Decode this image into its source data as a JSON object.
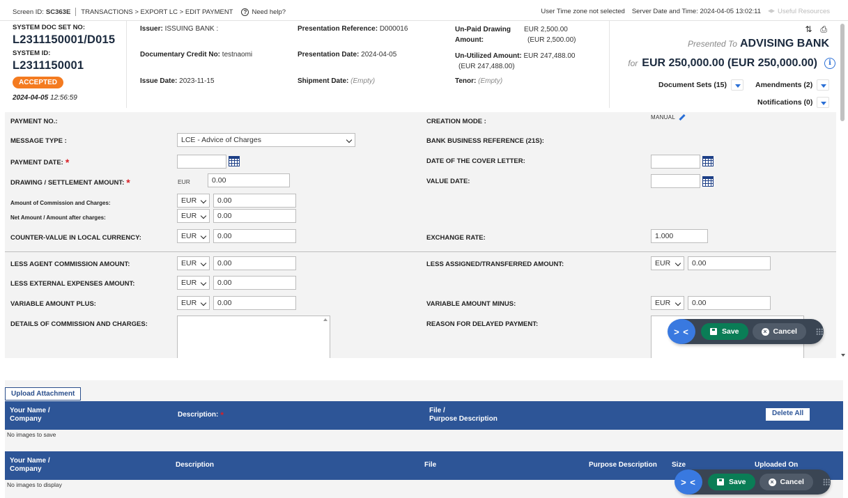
{
  "topbar": {
    "screen_id_label": "Screen ID:",
    "screen_id": "SC363E",
    "breadcrumb": "TRANSACTIONS > EXPORT LC > EDIT PAYMENT",
    "help": "Need help?",
    "timezone": "User Time zone not selected",
    "server_time": "Server Date and Time: 2024-04-05 13:02:11",
    "resources": "Useful Resources"
  },
  "header": {
    "docset_label": "SYSTEM DOC SET NO:",
    "docset": "L2311150001/D015",
    "sysid_label": "SYSTEM ID:",
    "sysid": "L2311150001",
    "status": "ACCEPTED",
    "date": "2024-04-05",
    "time": "12:56:59",
    "issuer_label": "Issuer:",
    "issuer": "ISSUING BANK :",
    "dc_label": "Documentary Credit No:",
    "dc": "testnaomi",
    "issue_label": "Issue Date:",
    "issue": "2023-11-15",
    "pres_ref_label": "Presentation Reference:",
    "pres_ref": "D000016",
    "pres_date_label": "Presentation Date:",
    "pres_date": "2024-04-05",
    "ship_label": "Shipment Date:",
    "ship": "(Empty)",
    "unpaid_label_1": "Un-Paid Drawing",
    "unpaid_label_2": "Amount:",
    "unpaid": "EUR 2,500.00",
    "unpaid_sub": "(EUR 2,500.00)",
    "unutil_label": "Un-Utilized Amount:",
    "unutil": "EUR 247,488.00",
    "unutil_sub": "(EUR 247,488.00)",
    "tenor_label": "Tenor:",
    "tenor": "(Empty)",
    "presented_to": "Presented To",
    "bank": "ADVISING BANK",
    "for": "for",
    "amount": "EUR 250,000.00 (EUR 250,000.00)",
    "doc_sets": "Document Sets (15)",
    "amendments": "Amendments (2)",
    "notifications": "Notifications (0)"
  },
  "form": {
    "payment_no": "PAYMENT NO.:",
    "creation_mode": "CREATION MODE :",
    "creation_mode_value": "MANUAL",
    "message_type": "MESSAGE TYPE :",
    "message_type_value": "LCE - Advice of Charges",
    "bank_ref": "BANK BUSINESS REFERENCE (21S):",
    "payment_date": "PAYMENT DATE:",
    "cover_letter": "DATE OF THE COVER LETTER:",
    "drawing_amount": "DRAWING / SETTLEMENT AMOUNT:",
    "drawing_currency": "EUR",
    "drawing_value": "0.00",
    "value_date": "VALUE DATE:",
    "commission": "Amount of Commission and Charges:",
    "net_amount": "Net Amount / Amount after charges:",
    "counter_value": "COUNTER-VALUE IN LOCAL CURRENCY:",
    "exchange_rate": "EXCHANGE RATE:",
    "exchange_rate_value": "1.000",
    "less_agent": "LESS AGENT COMMISSION AMOUNT:",
    "less_assigned": "LESS ASSIGNED/TRANSFERRED AMOUNT:",
    "less_external": "LESS EXTERNAL EXPENSES AMOUNT:",
    "var_plus": "VARIABLE AMOUNT PLUS:",
    "var_minus": "VARIABLE AMOUNT MINUS:",
    "details_commission": "DETAILS OF COMMISSION AND CHARGES:",
    "reason_delay": "REASON FOR DELAYED PAYMENT:",
    "currency": "EUR",
    "zero": "0.00"
  },
  "actions": {
    "save": "Save",
    "cancel": "Cancel",
    "toggle": "> <"
  },
  "attachments": {
    "upload": "Upload Attachment",
    "col_name_1": "Your Name /",
    "col_name_2": "Company",
    "col_desc": "Description:",
    "col_file_1": "File /",
    "col_file_2": "Purpose Description",
    "delete_all": "Delete All",
    "no_save": "No images to save",
    "col2_desc": "Description",
    "col2_file": "File",
    "col2_purpose": "Purpose Description",
    "col2_size": "Size",
    "col2_uploaded": "Uploaded On",
    "no_display": "No images to display"
  }
}
